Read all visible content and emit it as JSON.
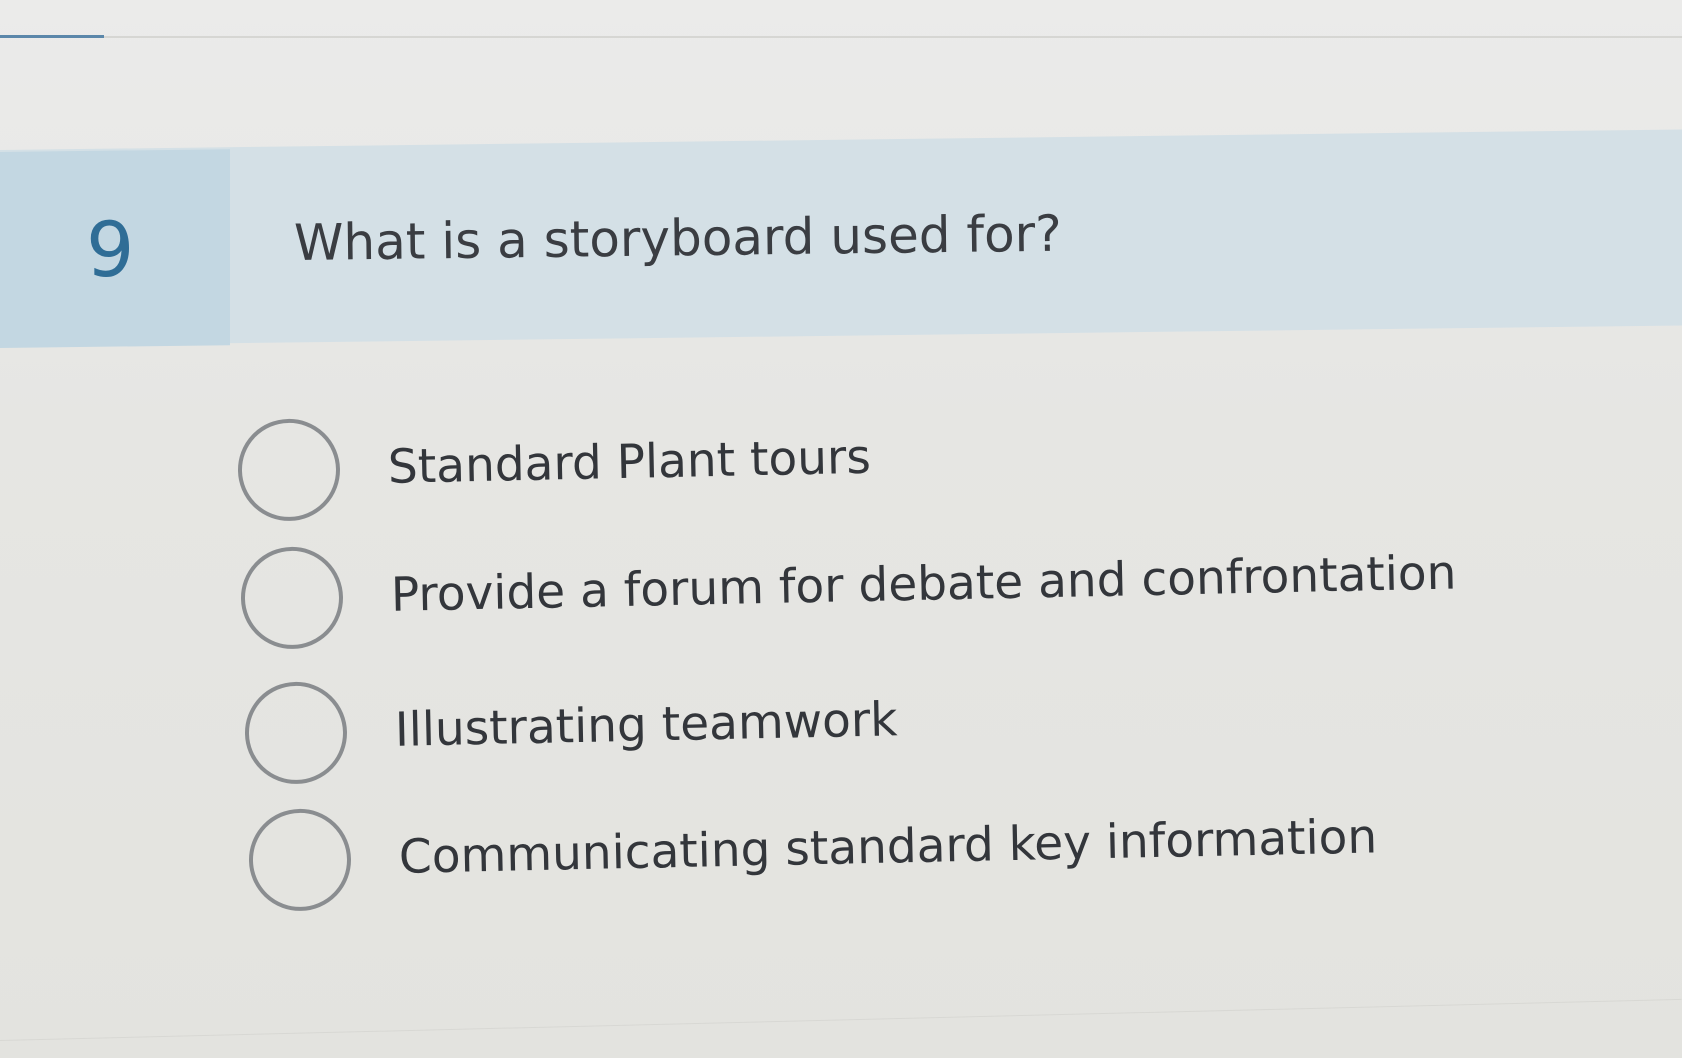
{
  "question": {
    "number": "9",
    "text": "What is a storyboard used for?"
  },
  "options": [
    {
      "label": "Standard Plant tours",
      "selected": false
    },
    {
      "label": "Provide a forum for debate and confrontation",
      "selected": false
    },
    {
      "label": "Illustrating teamwork",
      "selected": false
    },
    {
      "label": "Communicating standard key information",
      "selected": false
    }
  ],
  "colors": {
    "number_box": "#c3d7e2",
    "question_band": "#d4e0e6",
    "number_text": "#2f6d96",
    "accent_rule": "#5b87aa",
    "radio_border": "#8a8d90"
  }
}
